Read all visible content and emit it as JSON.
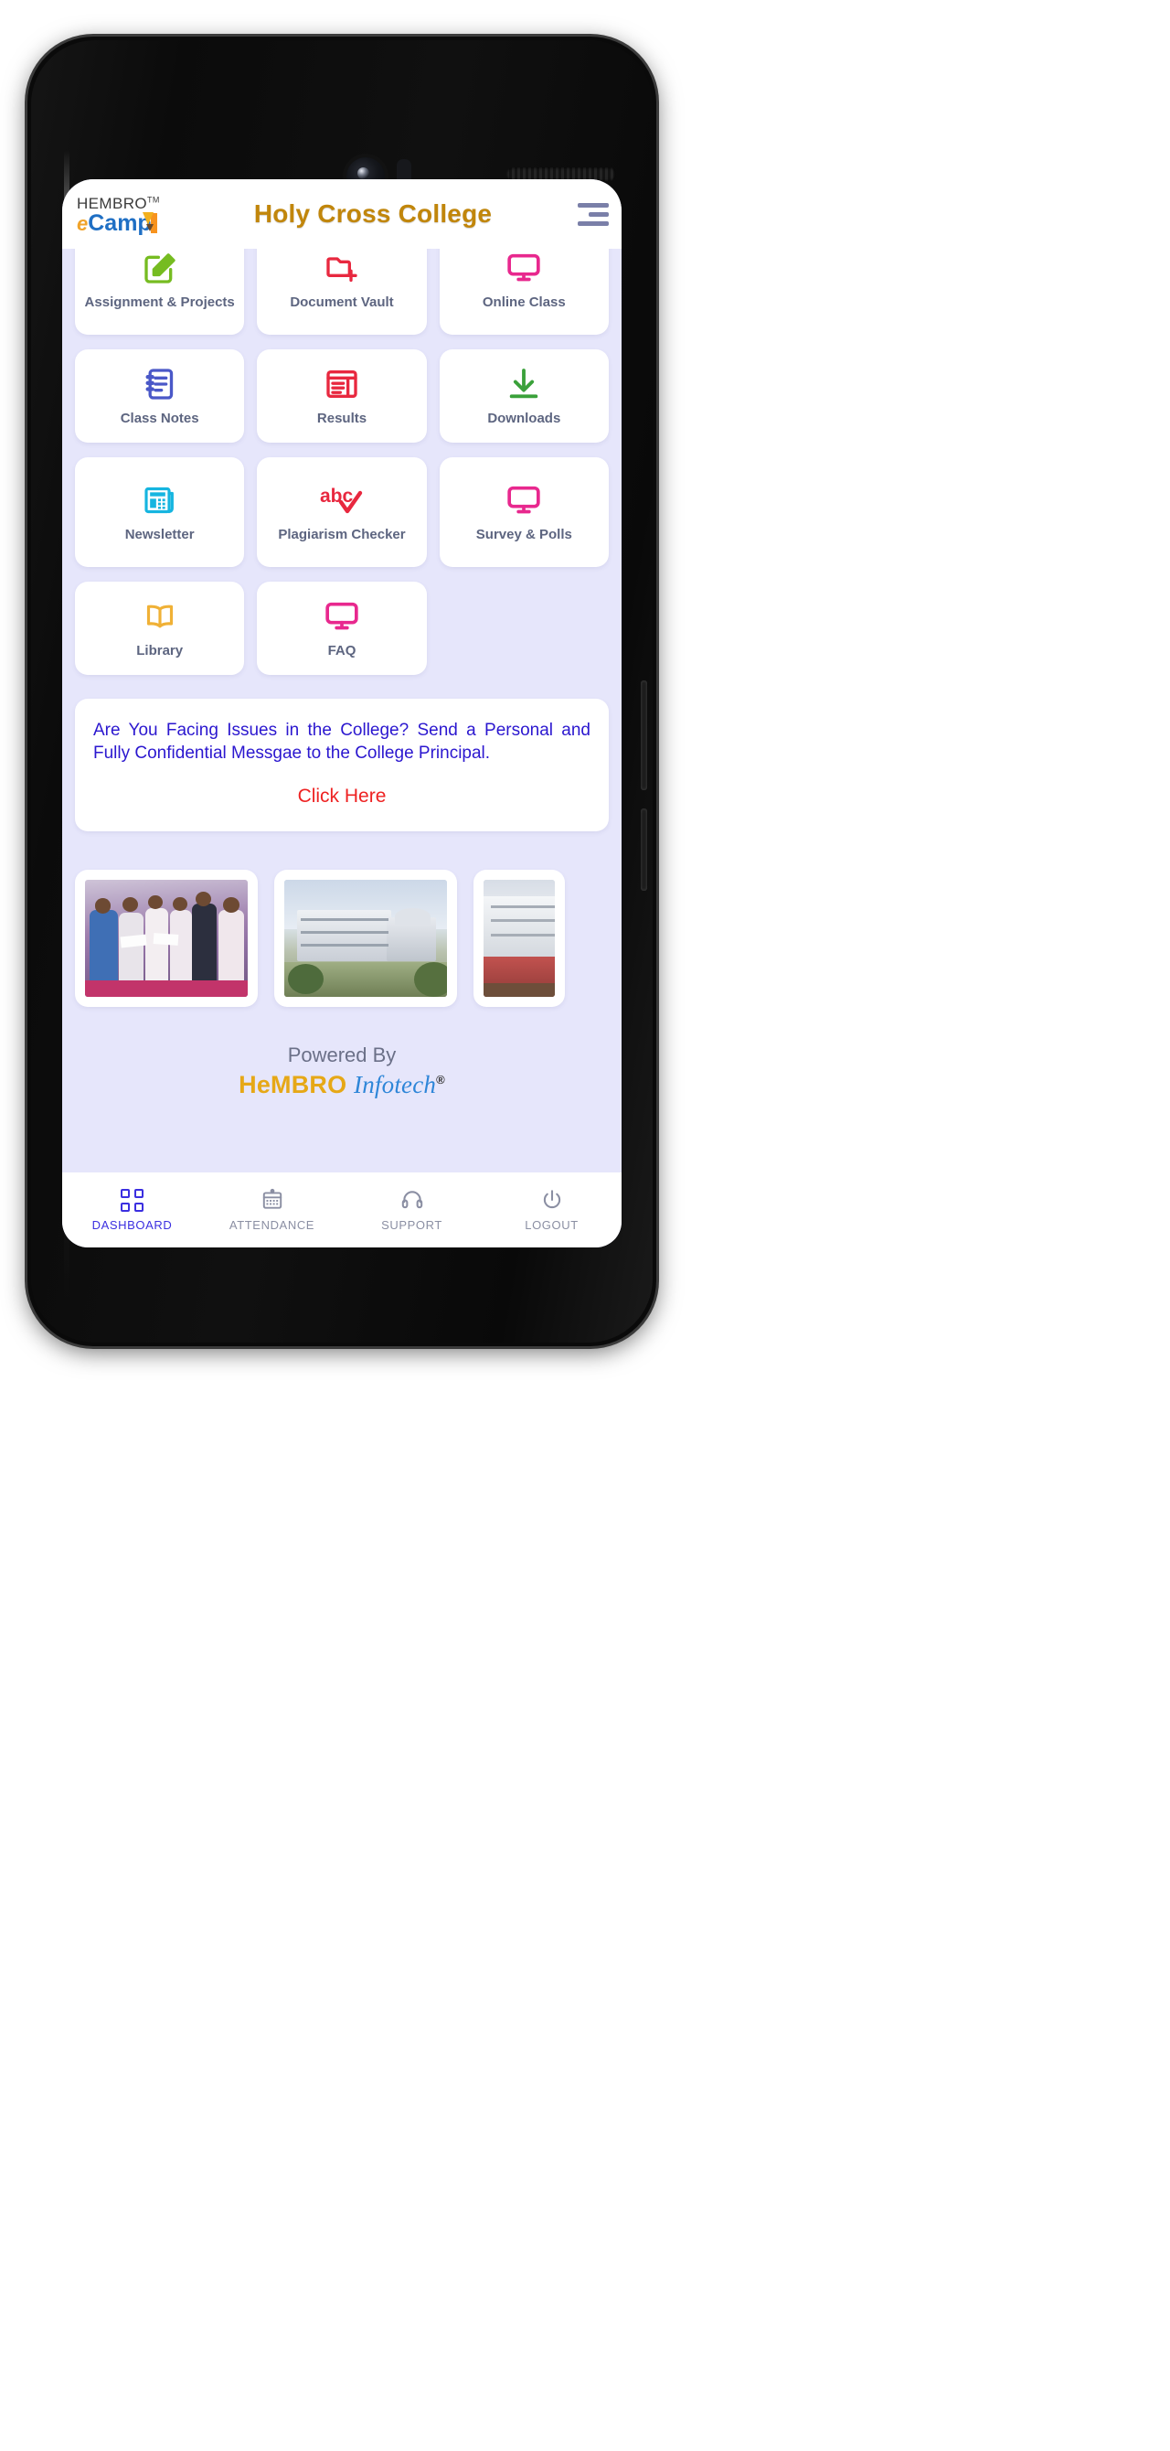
{
  "header": {
    "logo_top": "HEMBRO",
    "logo_tm": "TM",
    "logo_e": "e",
    "logo_camp": "Camp",
    "title": "Holy Cross College",
    "menu_icon": "hamburger-menu-icon"
  },
  "tiles": [
    {
      "label": "Assignment & Projects",
      "icon": "edit-square-icon",
      "color": "#76bc21"
    },
    {
      "label": "Document Vault",
      "icon": "folder-plus-icon",
      "color": "#e8283f"
    },
    {
      "label": "Online Class",
      "icon": "monitor-icon",
      "color": "#e8288e"
    },
    {
      "label": "Class Notes",
      "icon": "notebook-icon",
      "color": "#4a58c8"
    },
    {
      "label": "Results",
      "icon": "newspaper-icon",
      "color": "#e8283f"
    },
    {
      "label": "Downloads",
      "icon": "download-icon",
      "color": "#3aa13a"
    },
    {
      "label": "Newsletter",
      "icon": "news-sheet-icon",
      "color": "#16b5e0"
    },
    {
      "label": "Plagiarism Checker",
      "icon": "abc-check-icon",
      "color": "#e8283f"
    },
    {
      "label": "Survey & Polls",
      "icon": "monitor-icon",
      "color": "#e8288e"
    },
    {
      "label": "Library",
      "icon": "open-book-icon",
      "color": "#f0b136"
    },
    {
      "label": "FAQ",
      "icon": "monitor-icon",
      "color": "#e8288e"
    }
  ],
  "message_card": {
    "text": "Are You Facing Issues in the College? Send a Personal and Fully Confidential Messgae to the College Principal.",
    "link": "Click Here",
    "text_color": "#2b17cf",
    "link_color": "#ee2222"
  },
  "carousel": {
    "slides": [
      {
        "caption": "graduation-ceremony-photo"
      },
      {
        "caption": "college-campus-building-photo"
      },
      {
        "caption": "college-building-photo"
      }
    ]
  },
  "footer": {
    "powered_by": "Powered By",
    "brand_h": "H",
    "brand_e": "e",
    "brand_mbro": "MBRO",
    "brand_infotech": "Infotech",
    "brand_reg": "®"
  },
  "bottom_nav": {
    "items": [
      {
        "label": "DASHBOARD",
        "icon": "grid-squares-icon",
        "active": true
      },
      {
        "label": "ATTENDANCE",
        "icon": "calendar-icon",
        "active": false
      },
      {
        "label": "SUPPORT",
        "icon": "headset-icon",
        "active": false
      },
      {
        "label": "LOGOUT",
        "icon": "power-icon",
        "active": false
      }
    ],
    "active_color": "#3b2fe0",
    "inactive_color": "#8b8fa3"
  }
}
